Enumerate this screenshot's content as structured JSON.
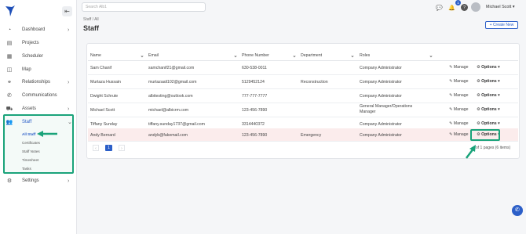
{
  "header": {
    "search_placeholder": "Search Alb1",
    "notification_count": "1",
    "user_name": "Michael Scott",
    "user_chevron": "▾"
  },
  "sidebar": {
    "collapse_glyph": "⇤",
    "items": [
      {
        "label": "Dashboard",
        "icon": "dashboard-icon",
        "chevron": "›"
      },
      {
        "label": "Projects",
        "icon": "projects-icon",
        "chevron": ""
      },
      {
        "label": "Scheduler",
        "icon": "scheduler-icon",
        "chevron": ""
      },
      {
        "label": "Map",
        "icon": "map-icon",
        "chevron": ""
      },
      {
        "label": "Relationships",
        "icon": "relationships-icon",
        "chevron": "›"
      },
      {
        "label": "Communications",
        "icon": "communications-icon",
        "chevron": ""
      },
      {
        "label": "Assets",
        "icon": "assets-icon",
        "chevron": "›"
      },
      {
        "label": "Staff",
        "icon": "staff-icon",
        "chevron": "⌄"
      },
      {
        "label": "Settings",
        "icon": "settings-icon",
        "chevron": "›"
      }
    ],
    "staff_sub": [
      "All Staff",
      "Certificates",
      "Staff Notes",
      "Timesheet",
      "Tasks"
    ]
  },
  "page": {
    "breadcrumb": "Staff / All",
    "title": "Staff",
    "create_label": "+ Create New"
  },
  "table": {
    "headers": [
      "Name",
      "Email",
      "Phone Number",
      "Department",
      "Roles"
    ],
    "rows": [
      {
        "name": "Sam Chanif",
        "email": "samchanif21@gmail.com",
        "phone": "630-538-0011",
        "department": "",
        "role": "Company Administrator"
      },
      {
        "name": "Murtaza Hussain",
        "email": "murtazaali102@gmail.com",
        "phone": "5129452124",
        "department": "Reconstruction",
        "role": "Company Administrator"
      },
      {
        "name": "Dwight Schrute",
        "email": "albitesting@outlook.com",
        "phone": "777-777-7777",
        "department": "",
        "role": "Company Administrator"
      },
      {
        "name": "Michael Scott",
        "email": "michael@albicrm.com",
        "phone": "123-456-7890",
        "department": "",
        "role": "General Manager/Operations Manager"
      },
      {
        "name": "Tiffany Sunday",
        "email": "tiffany.sunday1737@gmail.com",
        "phone": "3314440372",
        "department": "",
        "role": "Company Administrator"
      },
      {
        "name": "Andy Bernard",
        "email": "andyb@fakemail.com",
        "phone": "123-456-7890",
        "department": "Emergency",
        "role": "Company Administrator"
      }
    ],
    "manage_label": "Manage",
    "options_label": "Options ▾",
    "current_page": "1",
    "page_info": "of 1 pages (6 items)"
  },
  "colors": {
    "accent": "#2c5fc8",
    "highlight": "#1aa37a",
    "row_highlight": "#fbecec"
  }
}
